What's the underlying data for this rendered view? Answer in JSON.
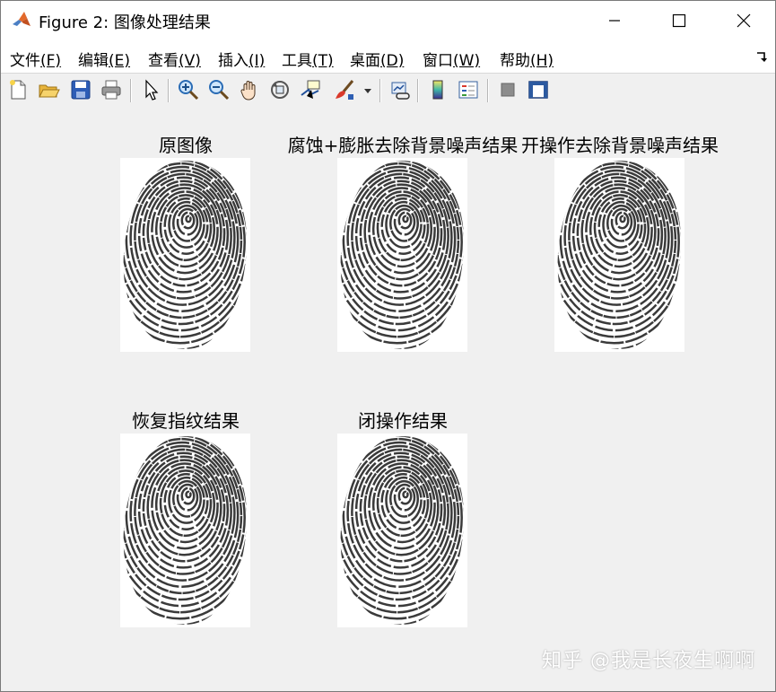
{
  "window": {
    "title": "Figure 2: 图像处理结果"
  },
  "menu": [
    {
      "label": "文件",
      "key": "(F)"
    },
    {
      "label": "编辑",
      "key": "(E)"
    },
    {
      "label": "查看",
      "key": "(V)"
    },
    {
      "label": "插入",
      "key": "(I)"
    },
    {
      "label": "工具",
      "key": "(T)"
    },
    {
      "label": "桌面",
      "key": "(D)"
    },
    {
      "label": "窗口",
      "key": "(W)"
    },
    {
      "label": "帮助",
      "key": "(H)"
    }
  ],
  "toolbar": {
    "icons": [
      "new-figure-icon",
      "open-file-icon",
      "save-icon",
      "print-icon",
      "edit-plot-icon",
      "zoom-in-icon",
      "zoom-out-icon",
      "pan-icon",
      "rotate-3d-icon",
      "data-cursor-icon",
      "brush-icon",
      "brush-dropdown-icon",
      "link-plot-icon",
      "insert-colorbar-icon",
      "insert-legend-icon",
      "hide-plot-tools-icon",
      "show-plot-tools-icon"
    ]
  },
  "axes": [
    {
      "title": "原图像"
    },
    {
      "title": "腐蚀+膨胀去除背景噪声结果"
    },
    {
      "title": "开操作去除背景噪声结果"
    },
    {
      "title": "恢复指纹结果"
    },
    {
      "title": "闭操作结果"
    }
  ],
  "watermark": "知乎 @我是长夜生啊啊",
  "colors": {
    "ridge": "#3a3a3a",
    "background": "#f0f0f0",
    "matlab_accent": "#0072bd"
  }
}
